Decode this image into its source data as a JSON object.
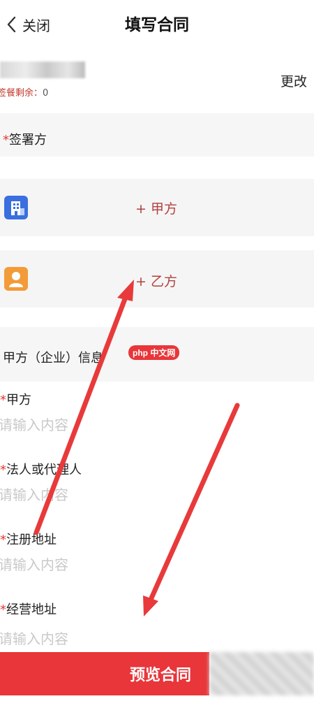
{
  "nav": {
    "back_label": "关闭",
    "title": "填写合同"
  },
  "account": {
    "remaining_label": "签餐剩余：",
    "remaining_value": "0",
    "change_label": "更改"
  },
  "signers": {
    "section_label": "签署方",
    "required_mark": "*",
    "party_a": {
      "icon": "building-icon",
      "icon_color": "#3b6fe0",
      "add_label": "+ 甲方"
    },
    "party_b": {
      "icon": "person-icon",
      "icon_color": "#f29b38",
      "add_label": "+ 乙方"
    }
  },
  "party_a_info": {
    "section_title": "甲方（企业）信息",
    "watermark": "php 中文网",
    "fields": [
      {
        "label": "甲方",
        "placeholder": "请输入内容"
      },
      {
        "label": "法人或代理人",
        "placeholder": "请输入内容"
      },
      {
        "label": "注册地址",
        "placeholder": "请输入内容"
      },
      {
        "label": "经营地址",
        "placeholder": "请输入内容"
      }
    ]
  },
  "footer": {
    "preview_label": "预览合同"
  },
  "colors": {
    "accent": "#e8363a",
    "required": "#e53935",
    "add_party": "#b0413e",
    "arrow": "#e83a3a"
  }
}
